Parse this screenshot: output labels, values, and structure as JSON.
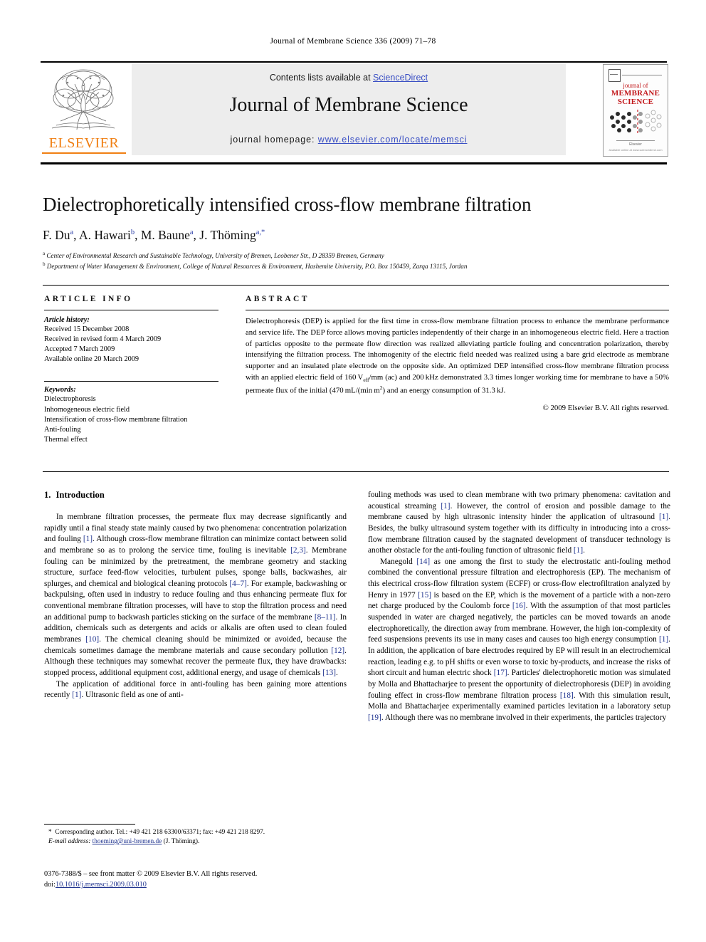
{
  "running_head": "Journal of Membrane Science 336 (2009) 71–78",
  "masthead": {
    "contents_prefix": "Contents lists available at ",
    "sciencedirect": "ScienceDirect",
    "journal_title": "Journal of Membrane Science",
    "homepage_prefix": "journal homepage: ",
    "homepage_url": "www.elsevier.com/locate/memsci",
    "publisher": "ELSEVIER",
    "link_color": "#3a4fc4"
  },
  "cover": {
    "line1": "journal of",
    "line2": "MEMBRANE",
    "line3": "SCIENCE",
    "foot1": "Elsevier",
    "foot2": "Available online at www.sciencedirect.com",
    "title_color": "#C2181B"
  },
  "article": {
    "title": "Dielectrophoretically intensified cross-flow membrane filtration",
    "authors": [
      {
        "name": "F. Du",
        "sup": "a"
      },
      {
        "name": "A. Hawari",
        "sup": "b"
      },
      {
        "name": "M. Baune",
        "sup": "a"
      },
      {
        "name": "J. Thöming",
        "sup": "a,*"
      }
    ],
    "affiliations": [
      {
        "mark": "a",
        "text": "Center of Environmental Research and Sustainable Technology, University of Bremen, Leobener Str., D 28359 Bremen, Germany"
      },
      {
        "mark": "b",
        "text": "Department of Water Management & Environment, College of Natural Resources & Environment, Hashemite University, P.O. Box 150459, Zarqa 13115, Jordan"
      }
    ]
  },
  "article_info": {
    "heading": "ARTICLE INFO",
    "history_label": "Article history:",
    "history": [
      "Received 15 December 2008",
      "Received in revised form 4 March 2009",
      "Accepted 7 March 2009",
      "Available online 20 March 2009"
    ],
    "keywords_label": "Keywords:",
    "keywords": [
      "Dielectrophoresis",
      "Inhomogeneous electric field",
      "Intensification of cross-flow membrane filtration",
      "Anti-fouling",
      "Thermal effect"
    ]
  },
  "abstract": {
    "heading": "ABSTRACT",
    "part1": "Dielectrophoresis (DEP) is applied for the first time in cross-flow membrane filtration process to enhance the membrane performance and service life. The DEP force allows moving particles independently of their charge in an inhomogeneous electric field. Here a traction of particles opposite to the permeate flow direction was realized alleviating particle fouling and concentration polarization, thereby intensifying the filtration process. The inhomogenity of the electric field needed was realized using a bare grid electrode as membrane supporter and an insulated plate electrode on the opposite side. An optimized DEP intensified cross-flow membrane filtration process with an applied electric field of 160 V",
    "sub1": "eff",
    "part2": "/mm (ac) and 200 kHz demonstrated 3.3 times longer working time for membrane to have a 50% permeate flux of the initial (470 mL/(min m",
    "sup1": "2",
    "part3": ") and an energy consumption of 31.3 kJ.",
    "copyright": "© 2009 Elsevier B.V. All rights reserved."
  },
  "body": {
    "section_number": "1.",
    "section_title": "Introduction",
    "left_paragraphs": [
      "In membrane filtration processes, the permeate flux may decrease significantly and rapidly until a final steady state mainly caused by two phenomena: concentration polarization and fouling [1]. Although cross-flow membrane filtration can minimize contact between solid and membrane so as to prolong the service time, fouling is inevitable [2,3]. Membrane fouling can be minimized by the pretreatment, the membrane geometry and stacking structure, surface feed-flow velocities, turbulent pulses, sponge balls, backwashes, air splurges, and chemical and biological cleaning protocols [4–7]. For example, backwashing or backpulsing, often used in industry to reduce fouling and thus enhancing permeate flux for conventional membrane filtration processes, will have to stop the filtration process and need an additional pump to backwash particles sticking on the surface of the membrane [8–11]. In addition, chemicals such as detergents and acids or alkalis are often used to clean fouled membranes [10]. The chemical cleaning should be minimized or avoided, because the chemicals sometimes damage the membrane materials and cause secondary pollution [12]. Although these techniques may somewhat recover the permeate flux, they have drawbacks: stopped process, additional equipment cost, additional energy, and usage of chemicals [13].",
      "The application of additional force in anti-fouling has been gaining more attentions recently [1]. Ultrasonic field as one of anti-"
    ],
    "right_paragraphs": [
      "fouling methods was used to clean membrane with two primary phenomena: cavitation and acoustical streaming [1]. However, the control of erosion and possible damage to the membrane caused by high ultrasonic intensity hinder the application of ultrasound [1]. Besides, the bulky ultrasound system together with its difficulty in introducing into a cross-flow membrane filtration caused by the stagnated development of transducer technology is another obstacle for the anti-fouling function of ultrasonic field [1].",
      "Manegold [14] as one among the first to study the electrostatic anti-fouling method combined the conventional pressure filtration and electrophoresis (EP). The mechanism of this electrical cross-flow filtration system (ECFF) or cross-flow electrofiltration analyzed by Henry in 1977 [15] is based on the EP, which is the movement of a particle with a non-zero net charge produced by the Coulomb force [16]. With the assumption of that most particles suspended in water are charged negatively, the particles can be moved towards an anode electrophoretically, the direction away from membrane. However, the high ion-complexity of feed suspensions prevents its use in many cases and causes too high energy consumption [1]. In addition, the application of bare electrodes required by EP will result in an electrochemical reaction, leading e.g. to pH shifts or even worse to toxic by-products, and increase the risks of short circuit and human electric shock [17]. Particles' dielectrophoretic motion was simulated by Molla and Bhattacharjee to present the opportunity of dielectrophoresis (DEP) in avoiding fouling effect in cross-flow membrane filtration process [18]. With this simulation result, Molla and Bhattacharjee experimentally examined particles levitation in a laboratory setup [19]. Although there was no membrane involved in their experiments, the particles trajectory"
    ],
    "citation_color": "#20348f"
  },
  "footnote": {
    "star": "*",
    "corresponding": "Corresponding author. Tel.: +49 421 218 63300/63371; fax: +49 421 218 8297.",
    "email_label": "E-mail address:",
    "email": "thoeming@uni-bremen.de",
    "email_owner": "(J. Thöming)."
  },
  "imprint": {
    "line1": "0376-7388/$ – see front matter © 2009 Elsevier B.V. All rights reserved.",
    "doi_label": "doi:",
    "doi": "10.1016/j.memsci.2009.03.010"
  }
}
